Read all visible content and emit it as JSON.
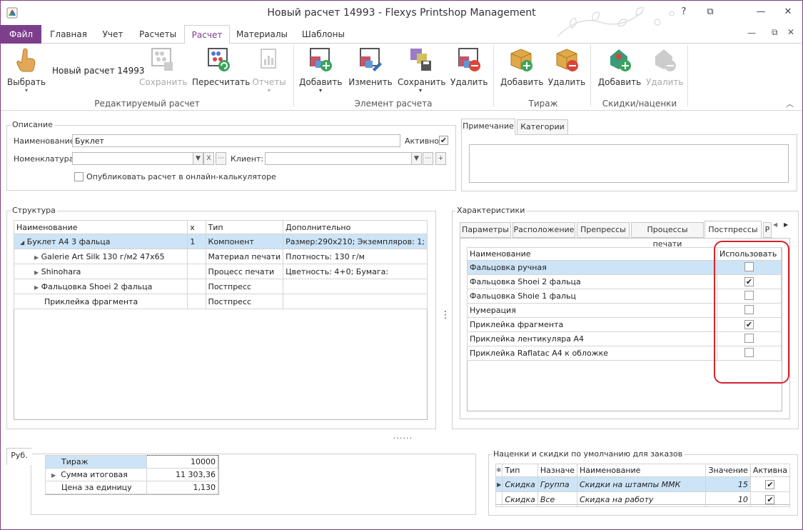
{
  "window": {
    "title": "Новый расчет 14993 - Flexys Printshop Management",
    "help": "?",
    "restore": "⧉",
    "minimize": "—",
    "close": "✕"
  },
  "ribbon_tabs": [
    "Файл",
    "Главная",
    "Учет",
    "Расчеты",
    "Расчет",
    "Материалы",
    "Шаблоны"
  ],
  "ribbon": {
    "select": "Выбрать",
    "calc_name": "Новый расчет 14993",
    "save": "Сохранить",
    "recalc": "Пересчитать",
    "reports": "Отчеты",
    "group1": "Редактируемый расчет",
    "add": "Добавить",
    "edit": "Изменить",
    "save2": "Сохранить",
    "delete": "Удалить",
    "group2": "Элемент расчета",
    "run_add": "Добавить",
    "run_delete": "Удалить",
    "group3": "Тираж",
    "disc_add": "Добавить",
    "disc_delete": "Удалить",
    "group4": "Скидки/наценки"
  },
  "description": {
    "title": "Описание",
    "name_label": "Наименование:",
    "name_value": "Буклет",
    "active_label": "Активно",
    "nomenclature_label": "Номенклатура:",
    "client_label": "Клиент:",
    "publish_label": "Опубликовать расчет в онлайн-калькуляторе",
    "clear_x": "X",
    "dots": "···",
    "plus": "+"
  },
  "notes_tabs": [
    "Примечание",
    "Категории"
  ],
  "structure": {
    "title": "Структура",
    "headers": [
      "Наименование",
      "x",
      "Тип",
      "Дополнительно"
    ],
    "rows": [
      {
        "name": "Буклет А4 3 фальца",
        "x": "1",
        "type": "Компонент",
        "extra": "Размер:290x210; Экземпляров: 1;"
      },
      {
        "name": "Galerie Art Silk 130 г/м2 47x65",
        "x": "",
        "type": "Материал печати",
        "extra": "Плотность: 130 г/м"
      },
      {
        "name": "Shinohara",
        "x": "",
        "type": "Процесс печати",
        "extra": "Цветность: 4+0; Бумага:"
      },
      {
        "name": "Фальцовка Shoei 2 фальца",
        "x": "",
        "type": "Постпресс",
        "extra": ""
      },
      {
        "name": "Приклейка фрагмента",
        "x": "",
        "type": "Постпресс",
        "extra": ""
      }
    ]
  },
  "characteristics": {
    "title": "Характеристики",
    "tabs": [
      "Параметры",
      "Расположение",
      "Препрессы",
      "Процессы печати",
      "Постпрессы",
      "Р"
    ],
    "headers": [
      "Наименование",
      "Использовать"
    ],
    "rows": [
      {
        "name": "Фальцовка ручная",
        "use": ""
      },
      {
        "name": "Фальцовка Shoei 2 фальца",
        "use": "✔"
      },
      {
        "name": "Фальцовка Shoie 1 фальц",
        "use": ""
      },
      {
        "name": "Нумерация",
        "use": ""
      },
      {
        "name": "Приклейка фрагмента",
        "use": "✔"
      },
      {
        "name": "Приклейка лентикуляра А4",
        "use": ""
      },
      {
        "name": "Приклейка Raflatac А4 к обложке",
        "use": ""
      }
    ]
  },
  "totals": {
    "tab": "Руб.",
    "rows": [
      {
        "label": "Тираж",
        "value": "10000"
      },
      {
        "label": "Сумма итоговая",
        "value": "11 303,36"
      },
      {
        "label": "Цена за единицу",
        "value": "1,130"
      }
    ]
  },
  "discounts": {
    "title": "Наценки и скидки по умолчанию для заказов",
    "headers": [
      "Тип",
      "Назначе",
      "Наименование",
      "Значение",
      "Активна"
    ],
    "rows": [
      {
        "type": "Скидка",
        "target": "Группа",
        "name": "Скидки на штампы ММК",
        "value": "15",
        "active": "✔"
      },
      {
        "type": "Скидка",
        "target": "Все",
        "name": "Скидка на работу",
        "value": "10",
        "active": "✔"
      }
    ]
  },
  "splitter_h": "......",
  "splitter_v": "⋮",
  "colors": {
    "accent": "#7d3f8c",
    "highlight": "#d4232b",
    "selection": "#cde4f7"
  }
}
